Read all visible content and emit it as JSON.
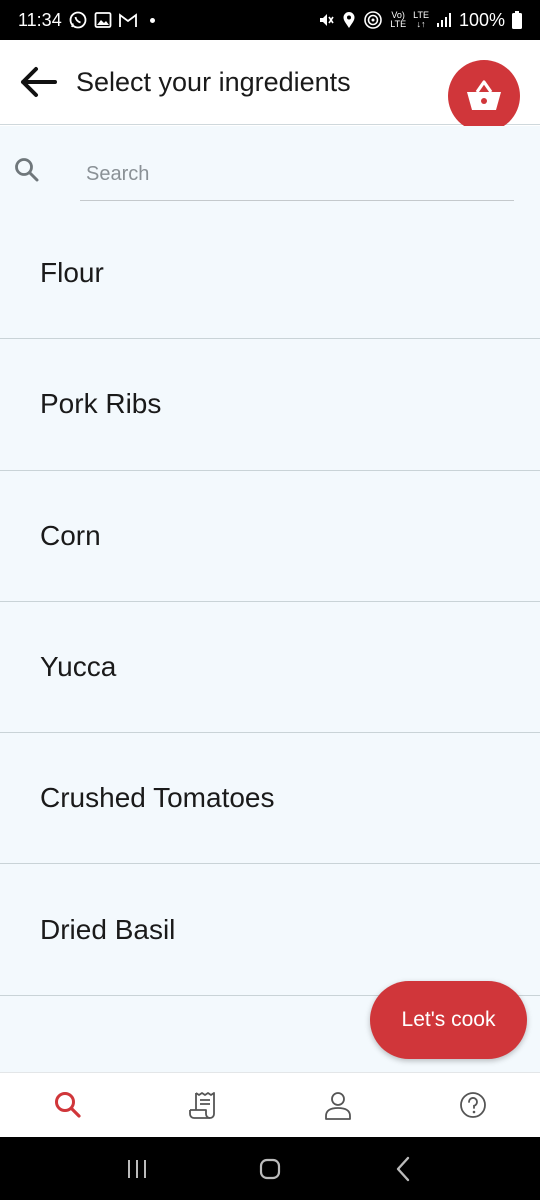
{
  "status_bar": {
    "time": "11:34",
    "battery": "100%",
    "left_icons": [
      "whatsapp-icon",
      "gallery-icon",
      "gmail-icon",
      "dot-icon"
    ],
    "right_icons": [
      "mute-icon",
      "location-icon",
      "hotspot-icon",
      "volte-icon",
      "lte-icon",
      "signal-icon",
      "battery-icon"
    ],
    "volte_label": "Vo)\nLTE",
    "lte_label": "LTE"
  },
  "header": {
    "title": "Select your ingredients",
    "back_icon": "arrow-left-icon",
    "basket_icon": "basket-icon"
  },
  "search": {
    "placeholder": "Search",
    "value": ""
  },
  "ingredients": [
    {
      "label": "Flour"
    },
    {
      "label": "Pork Ribs"
    },
    {
      "label": "Corn"
    },
    {
      "label": "Yucca"
    },
    {
      "label": "Crushed Tomatoes"
    },
    {
      "label": "Dried Basil"
    }
  ],
  "fab": {
    "label": "Let's cook"
  },
  "bottom_nav": [
    {
      "icon": "search-icon",
      "active": true
    },
    {
      "icon": "receipt-icon",
      "active": false
    },
    {
      "icon": "profile-icon",
      "active": false
    },
    {
      "icon": "help-icon",
      "active": false
    }
  ],
  "colors": {
    "accent": "#d0363a",
    "list_background": "#f3f9fd",
    "divider": "#c9d3d7"
  }
}
